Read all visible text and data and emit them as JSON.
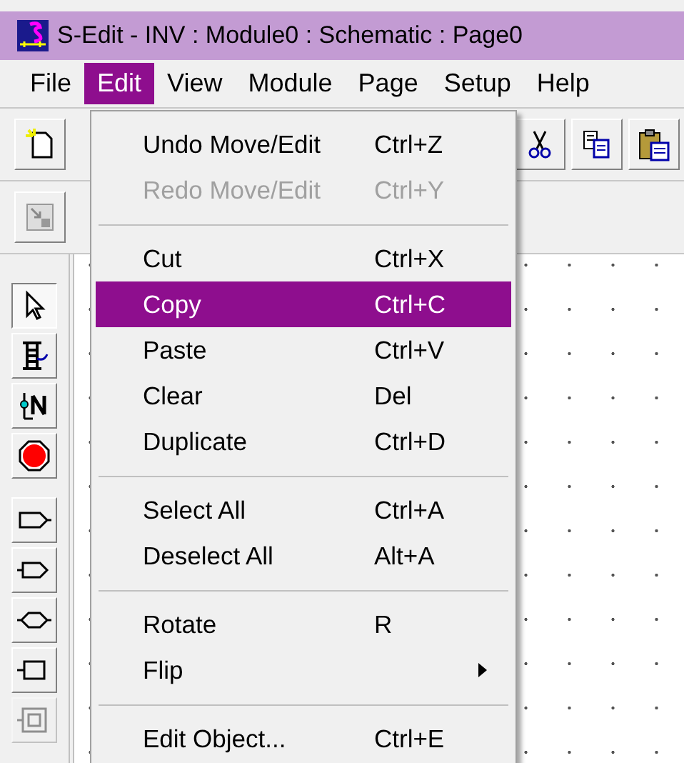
{
  "window": {
    "title": "S-Edit - INV : Module0 : Schematic : Page0"
  },
  "menubar": [
    {
      "label": "File",
      "selected": false
    },
    {
      "label": "Edit",
      "selected": true
    },
    {
      "label": "View",
      "selected": false
    },
    {
      "label": "Module",
      "selected": false
    },
    {
      "label": "Page",
      "selected": false
    },
    {
      "label": "Setup",
      "selected": false
    },
    {
      "label": "Help",
      "selected": false
    }
  ],
  "tools": [
    {
      "kind": "pointer",
      "selected": true,
      "disabled": false
    },
    {
      "kind": "instance",
      "selected": false,
      "disabled": false
    },
    {
      "kind": "net",
      "selected": false,
      "disabled": false
    },
    {
      "kind": "stop",
      "selected": false,
      "disabled": false
    },
    {
      "kind": "output-port",
      "selected": false,
      "disabled": false
    },
    {
      "kind": "input-port",
      "selected": false,
      "disabled": false
    },
    {
      "kind": "bidir-port",
      "selected": false,
      "disabled": false
    },
    {
      "kind": "other-port",
      "selected": false,
      "disabled": false
    },
    {
      "kind": "global-port",
      "selected": false,
      "disabled": true
    }
  ],
  "edit_menu": [
    {
      "kind": "item",
      "label": "Undo Move/Edit",
      "shortcut": "Ctrl+Z",
      "disabled": false,
      "selected": false,
      "submenu": false
    },
    {
      "kind": "item",
      "label": "Redo Move/Edit",
      "shortcut": "Ctrl+Y",
      "disabled": true,
      "selected": false,
      "submenu": false
    },
    {
      "kind": "separator"
    },
    {
      "kind": "item",
      "label": "Cut",
      "shortcut": "Ctrl+X",
      "disabled": false,
      "selected": false,
      "submenu": false
    },
    {
      "kind": "item",
      "label": "Copy",
      "shortcut": "Ctrl+C",
      "disabled": false,
      "selected": true,
      "submenu": false
    },
    {
      "kind": "item",
      "label": "Paste",
      "shortcut": "Ctrl+V",
      "disabled": false,
      "selected": false,
      "submenu": false
    },
    {
      "kind": "item",
      "label": "Clear",
      "shortcut": "Del",
      "disabled": false,
      "selected": false,
      "submenu": false
    },
    {
      "kind": "item",
      "label": "Duplicate",
      "shortcut": "Ctrl+D",
      "disabled": false,
      "selected": false,
      "submenu": false
    },
    {
      "kind": "separator"
    },
    {
      "kind": "item",
      "label": "Select All",
      "shortcut": "Ctrl+A",
      "disabled": false,
      "selected": false,
      "submenu": false
    },
    {
      "kind": "item",
      "label": "Deselect All",
      "shortcut": "Alt+A",
      "disabled": false,
      "selected": false,
      "submenu": false
    },
    {
      "kind": "separator"
    },
    {
      "kind": "item",
      "label": "Rotate",
      "shortcut": "R",
      "disabled": false,
      "selected": false,
      "submenu": false
    },
    {
      "kind": "item",
      "label": "Flip",
      "disabled": false,
      "selected": false,
      "submenu": true
    },
    {
      "kind": "separator"
    },
    {
      "kind": "item",
      "label": "Edit Object...",
      "shortcut": "Ctrl+E",
      "disabled": false,
      "selected": false,
      "submenu": false
    }
  ]
}
